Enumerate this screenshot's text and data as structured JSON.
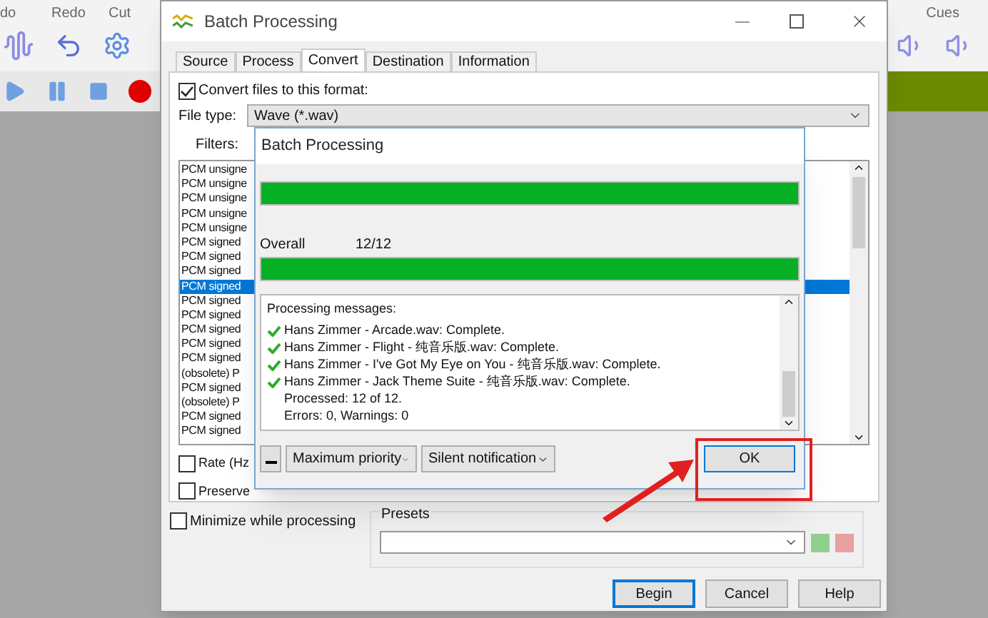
{
  "app": {
    "toolbar_labels": [
      "do",
      "Redo",
      "Cut"
    ],
    "right_label": "Cues"
  },
  "dialog": {
    "title": "Batch Processing",
    "tabs": [
      {
        "label": "Source",
        "selected": false
      },
      {
        "label": "Process",
        "selected": false
      },
      {
        "label": "Convert",
        "selected": true
      },
      {
        "label": "Destination",
        "selected": false
      },
      {
        "label": "Information",
        "selected": false
      }
    ],
    "convert": {
      "label": "Convert files to this format:",
      "checked": true
    },
    "file_type": {
      "label": "File type:",
      "value": "Wave (*.wav)"
    },
    "filters": {
      "label": "Filters:"
    },
    "formats": [
      {
        "text": "PCM unsigne",
        "selected": false
      },
      {
        "text": "PCM unsigne",
        "selected": false
      },
      {
        "text": "PCM unsigne",
        "selected": false
      },
      {
        "text": "PCM unsigne",
        "selected": false
      },
      {
        "text": "PCM unsigne",
        "selected": false
      },
      {
        "text": "PCM signed",
        "selected": false
      },
      {
        "text": "PCM signed",
        "selected": false
      },
      {
        "text": "PCM signed",
        "selected": false
      },
      {
        "text": "PCM signed",
        "selected": true
      },
      {
        "text": "PCM signed",
        "selected": false
      },
      {
        "text": "PCM signed",
        "selected": false
      },
      {
        "text": "PCM signed",
        "selected": false
      },
      {
        "text": "PCM signed",
        "selected": false
      },
      {
        "text": "PCM signed",
        "selected": false
      },
      {
        "text": "(obsolete) P",
        "selected": false
      },
      {
        "text": "PCM signed",
        "selected": false
      },
      {
        "text": "(obsolete) P",
        "selected": false
      },
      {
        "text": "PCM signed",
        "selected": false
      },
      {
        "text": "PCM signed",
        "selected": false
      }
    ],
    "options": [
      {
        "label": "Rate (Hz",
        "checked": false
      },
      {
        "label": "Preserve",
        "checked": false
      }
    ],
    "minimize": {
      "label": "Minimize while processing",
      "checked": false
    },
    "presets": {
      "label": "Presets"
    },
    "buttons": [
      {
        "label": "Begin",
        "default": true
      },
      {
        "label": "Cancel",
        "default": false
      },
      {
        "label": "Help",
        "default": false
      }
    ]
  },
  "progress": {
    "title": "Batch Processing",
    "file_bar": {
      "level": 1
    },
    "overall": {
      "label": "Overall",
      "count": "12/12",
      "level": 1
    },
    "messages_title": "Processing messages:",
    "messages": [
      {
        "text": "Hans Zimmer - Arcade.wav: Complete.",
        "ok": true
      },
      {
        "text": "Hans Zimmer - Flight - 纯音乐版.wav: Complete.",
        "ok": true
      },
      {
        "text": "Hans Zimmer - I've Got My Eye on You - 纯音乐版.wav: Complete.",
        "ok": true
      },
      {
        "text": "Hans Zimmer - Jack Theme Suite - 纯音乐版.wav: Complete.",
        "ok": true
      },
      {
        "text": "Processed: 12 of 12.",
        "ok": false
      },
      {
        "text": "Errors: 0,  Warnings: 0",
        "ok": false
      }
    ],
    "priority": "Maximum priority",
    "notification": "Silent notification",
    "ok_button": "OK"
  }
}
